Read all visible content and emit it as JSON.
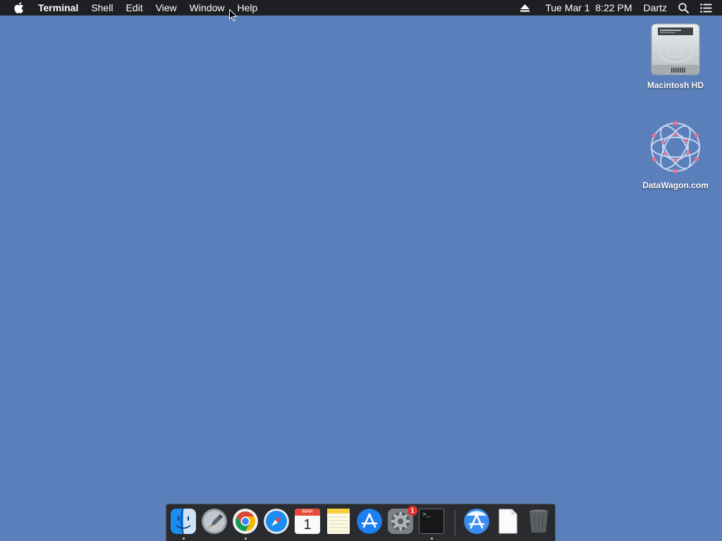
{
  "menubar": {
    "app_name": "Terminal",
    "menus": [
      "Shell",
      "Edit",
      "View",
      "Window",
      "Help"
    ],
    "status": {
      "datetime": "Tue Mar 1  8:22 PM",
      "user": "Dartz"
    },
    "icons": [
      "apple-icon",
      "eject-icon",
      "spotlight-search-icon",
      "notification-center-icon"
    ]
  },
  "desktop": {
    "background_color": "#5a7fbb",
    "icons": [
      {
        "label": "Macintosh HD",
        "icon": "hard-drive-icon"
      },
      {
        "label": "DataWagon.com",
        "icon": "network-volume-icon"
      }
    ]
  },
  "dock": {
    "apps": [
      {
        "name": "Finder",
        "icon": "finder-icon",
        "running": true
      },
      {
        "name": "Launchpad",
        "icon": "launchpad-icon",
        "running": false
      },
      {
        "name": "Google Chrome",
        "icon": "chrome-icon",
        "running": true
      },
      {
        "name": "Safari",
        "icon": "safari-icon",
        "running": false
      },
      {
        "name": "Calendar",
        "icon": "calendar-icon",
        "running": false,
        "month": "MAR",
        "day": "1"
      },
      {
        "name": "Notes",
        "icon": "notes-icon",
        "running": false
      },
      {
        "name": "App Store",
        "icon": "app-store-icon",
        "running": false
      },
      {
        "name": "System Preferences",
        "icon": "system-preferences-icon",
        "running": false,
        "badge": "1"
      },
      {
        "name": "Terminal",
        "icon": "terminal-icon",
        "running": true,
        "prompt": ">_"
      }
    ],
    "others": [
      {
        "name": "Applications",
        "icon": "applications-folder-icon"
      },
      {
        "name": "Document",
        "icon": "document-icon"
      },
      {
        "name": "Trash",
        "icon": "trash-icon"
      }
    ]
  }
}
